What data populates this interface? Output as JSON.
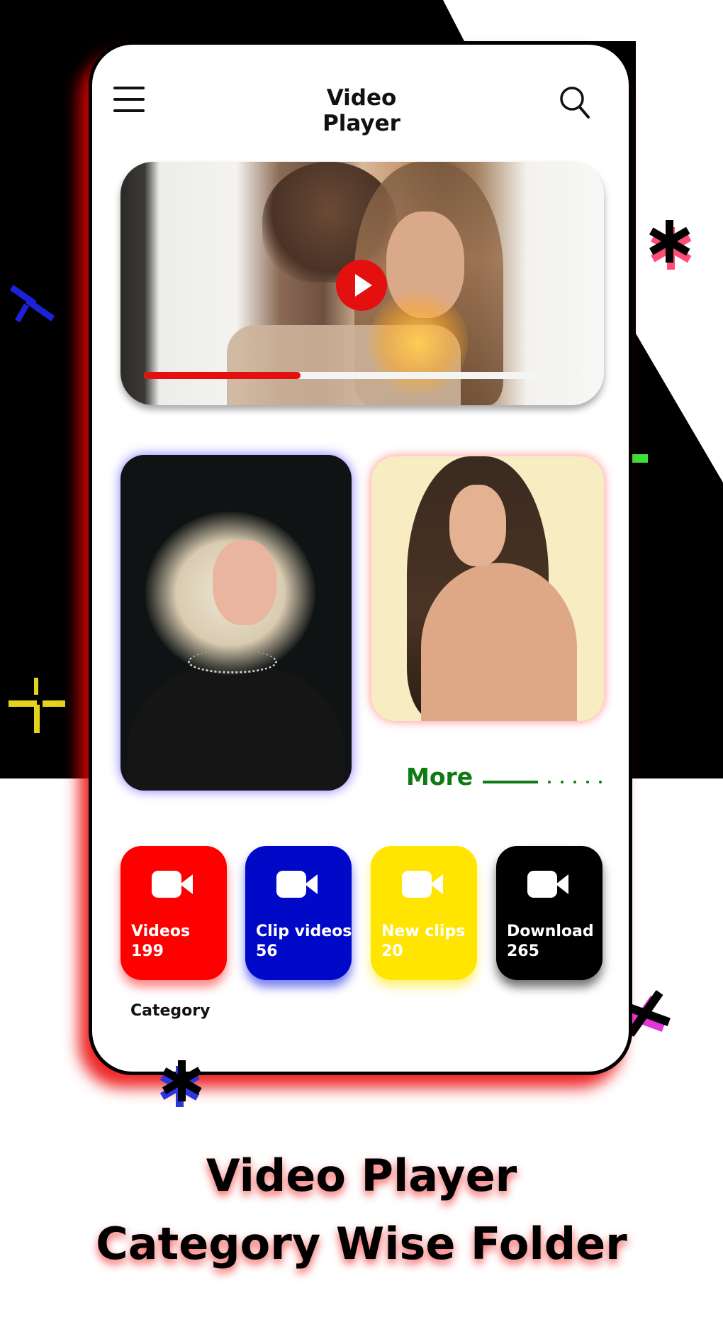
{
  "header": {
    "title": "Video Player",
    "menu_icon": "hamburger-menu-icon",
    "search_icon": "search-icon"
  },
  "hero_video": {
    "play_icon": "play-icon",
    "progress_percent": 36,
    "colors": {
      "progress_fill": "#e41010",
      "progress_track": "#f4f4f4"
    }
  },
  "featured": {
    "more_label": "More"
  },
  "categories": [
    {
      "name": "Videos",
      "count": "199",
      "color": "#fe0000",
      "icon": "video-camera-icon"
    },
    {
      "name": "Clip videos",
      "count": "56",
      "color": "#0009c8",
      "icon": "video-camera-icon"
    },
    {
      "name": "New clips",
      "count": "20",
      "color": "#ffe500",
      "icon": "video-camera-icon"
    },
    {
      "name": "Download",
      "count": "265",
      "color": "#000000",
      "icon": "video-camera-icon"
    }
  ],
  "category_label": "Category",
  "promo": {
    "line1": "Video Player",
    "line2": "Category Wise Folder"
  }
}
